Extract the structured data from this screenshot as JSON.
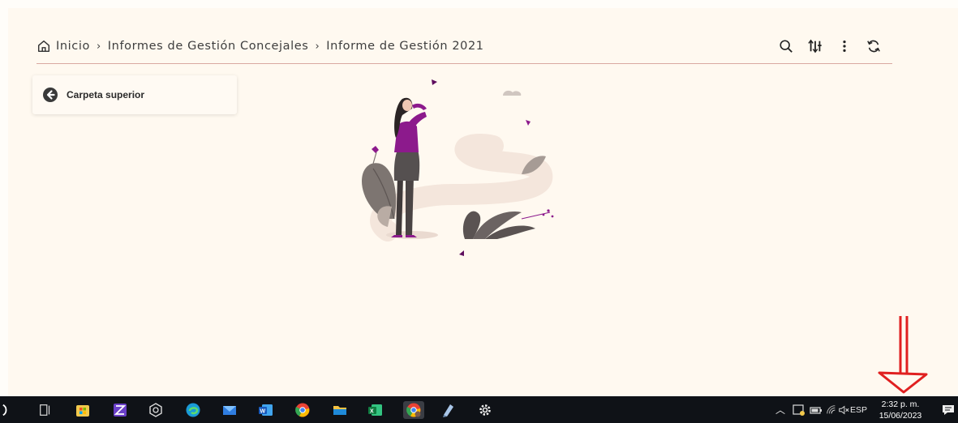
{
  "breadcrumb": {
    "home": "Inicio",
    "level1": "Informes de Gestión Concejales",
    "level2": "Informe de Gestión 2021",
    "separator": "›"
  },
  "toolbar": {
    "icons": [
      "search-icon",
      "sort-icon",
      "more-vertical-icon",
      "refresh-icon"
    ]
  },
  "folder": {
    "parent_label": "Carpeta superior"
  },
  "taskbar": {
    "apps": [
      "search-icon",
      "task-view-icon",
      "store-icon",
      "scanner-icon",
      "app-icon",
      "edge-icon",
      "mail-icon",
      "word-icon",
      "chrome-icon",
      "file-explorer-icon",
      "excel-icon",
      "chrome-profile-icon",
      "pen-icon",
      "settings-icon"
    ],
    "language": "ESP",
    "time": "2:32 p. m.",
    "date": "15/06/2023"
  },
  "colors": {
    "page_bg": "#fff9f0",
    "divider": "#d9a8a0",
    "accent_purple": "#8c1a8c",
    "annotation_red": "#e02020",
    "taskbar_bg": "#0f1217"
  }
}
